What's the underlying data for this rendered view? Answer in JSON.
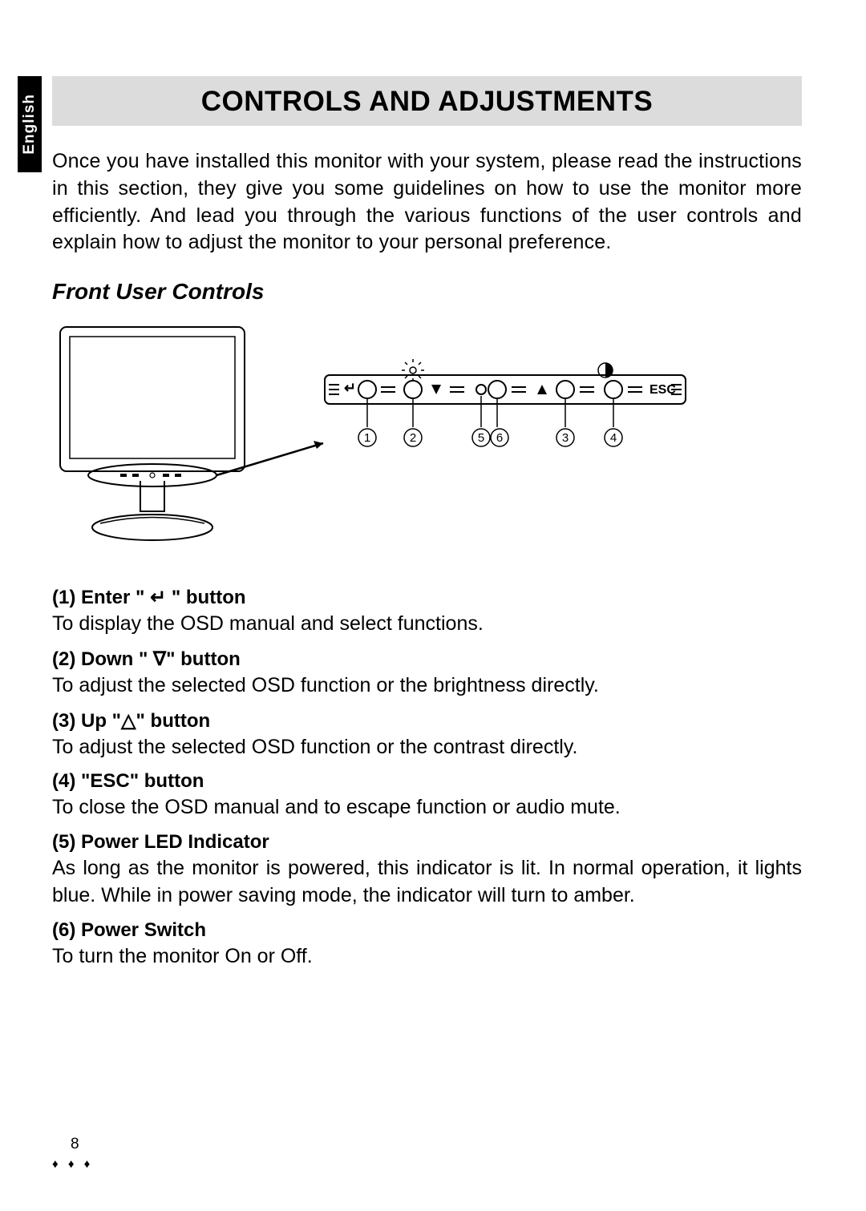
{
  "side_tab": "English",
  "title": "CONTROLS AND ADJUSTMENTS",
  "intro": "Once you have installed this monitor with your system, please read the instructions in this section, they give you some guidelines on how to use the monitor more efficiently.  And lead you through the various functions of the user controls and explain how to adjust the monitor to your personal preference.",
  "subhead": "Front User Controls",
  "figure": {
    "esc_label": "ESC",
    "callouts": [
      "1",
      "2",
      "5",
      "6",
      "3",
      "4"
    ]
  },
  "items": [
    {
      "title": "(1) Enter \" ↵ \" button",
      "desc": "To display the OSD manual and select functions."
    },
    {
      "title": "(2) Down \" ∇\" button",
      "desc": "To adjust the selected OSD function or the brightness directly."
    },
    {
      "title": "(3) Up \"△\" button",
      "desc": "To adjust the selected OSD function or the contrast directly."
    },
    {
      "title": "(4) \"ESC\" button",
      "desc": "To close the OSD manual and to escape function or audio mute."
    },
    {
      "title": "(5) Power LED Indicator",
      "desc": "As long as the monitor is powered, this indicator is lit. In normal operation, it lights blue. While in power saving mode, the indicator will turn to amber."
    },
    {
      "title": "(6) Power Switch",
      "desc": "To turn the monitor On or Off."
    }
  ],
  "page_number": "8",
  "diamonds": "♦ ♦ ♦"
}
